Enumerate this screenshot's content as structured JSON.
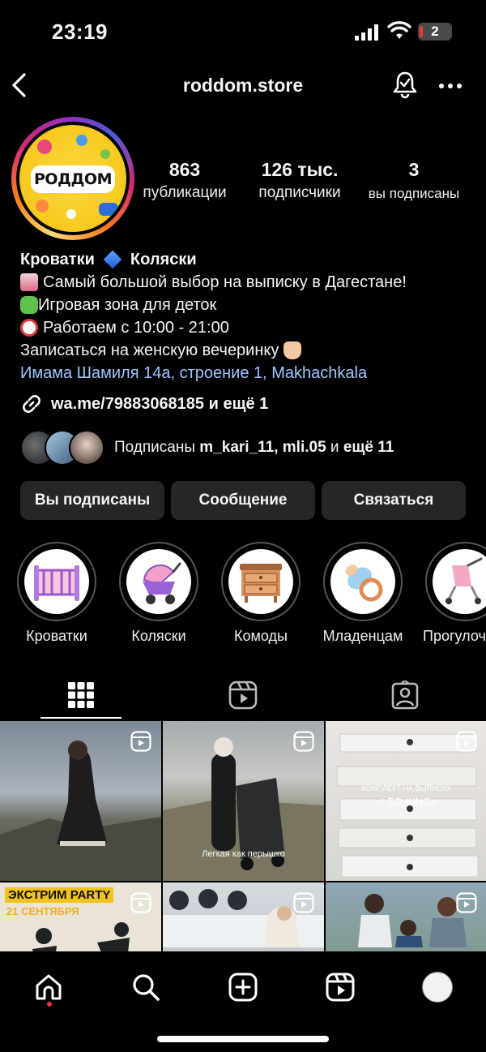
{
  "status": {
    "time": "23:19",
    "battery": "2"
  },
  "header": {
    "username": "roddom.store"
  },
  "profile": {
    "logo_text": "РОДДОМ",
    "stats": [
      {
        "value": "863",
        "label": "публикации"
      },
      {
        "value": "126 тыс.",
        "label": "подписчики"
      },
      {
        "value": "3",
        "label": "вы подписаны"
      }
    ]
  },
  "bio": {
    "name_left": "Кроватки",
    "name_right": "Коляски",
    "line1": "Самый большой выбор на выписку в Дагестане!",
    "line2": "Игровая зона для деток",
    "line3": "Работаем с 10:00 - 21:00",
    "line4": "Записаться на женскую вечеринку",
    "address": "Имама Шамиля 14а, строение 1, Makhachkala",
    "link": "wa.me/79883068185 и ещё 1"
  },
  "followed_by": {
    "prefix": "Подписаны ",
    "names": "m_kari_11, mli.05",
    "middle": " и ",
    "suffix": "ещё 11"
  },
  "buttons": {
    "following": "Вы подписаны",
    "message": "Сообщение",
    "contact": "Связаться"
  },
  "highlights": [
    {
      "label": "Кроватки"
    },
    {
      "label": "Коляски"
    },
    {
      "label": "Комоды"
    },
    {
      "label": "Младенцам"
    },
    {
      "label": "Прогулоч"
    }
  ],
  "grid": {
    "post2_caption": "Легкая как перышко",
    "post3_line1": "КОМПЛЕКТ НА ВЫПИСКУ",
    "post3_line2": "«LEO.KING»",
    "post4_title": "ЭКСТРИМ PARTY",
    "post4_date": "21 СЕНТЯБРЯ"
  },
  "colors": {
    "background": "#000000",
    "button_bg": "#262626",
    "link_blue": "#9ec6ff",
    "notification_dot": "#ff3040"
  }
}
